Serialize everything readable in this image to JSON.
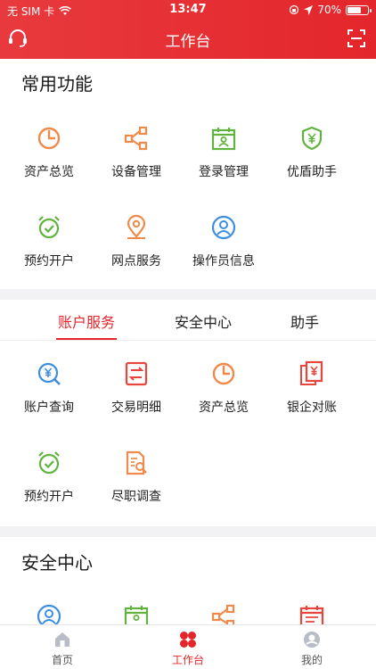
{
  "status": {
    "carrier": "无 SIM 卡",
    "time": "13:47",
    "battery": "70%",
    "battery_level": 0.7
  },
  "header": {
    "title": "工作台"
  },
  "common": {
    "title": "常用功能",
    "items": [
      {
        "label": "资产总览",
        "icon": "pie-chart-icon"
      },
      {
        "label": "设备管理",
        "icon": "share-nodes-icon"
      },
      {
        "label": "登录管理",
        "icon": "calendar-user-icon"
      },
      {
        "label": "优盾助手",
        "icon": "yen-shield-icon"
      },
      {
        "label": "预约开户",
        "icon": "alarm-clock-check-icon"
      },
      {
        "label": "网点服务",
        "icon": "map-pin-icon"
      },
      {
        "label": "操作员信息",
        "icon": "user-circle-icon"
      }
    ]
  },
  "services": {
    "tabs": [
      "账户服务",
      "安全中心",
      "助手"
    ],
    "items": [
      {
        "label": "账户查询",
        "icon": "yen-search-icon"
      },
      {
        "label": "交易明细",
        "icon": "transfer-list-icon"
      },
      {
        "label": "资产总览",
        "icon": "pie-chart-icon"
      },
      {
        "label": "银企对账",
        "icon": "yen-docs-icon"
      },
      {
        "label": "预约开户",
        "icon": "alarm-clock-check-icon"
      },
      {
        "label": "尽职调查",
        "icon": "document-search-icon"
      }
    ]
  },
  "security": {
    "title": "安全中心"
  },
  "nav": {
    "home": "首页",
    "workbench": "工作台",
    "mine": "我的"
  },
  "colors": {
    "brand": "#e3262b",
    "orange": "#f08a4b",
    "green": "#62b23f",
    "blue": "#3d8ee0",
    "red": "#e8463c"
  }
}
